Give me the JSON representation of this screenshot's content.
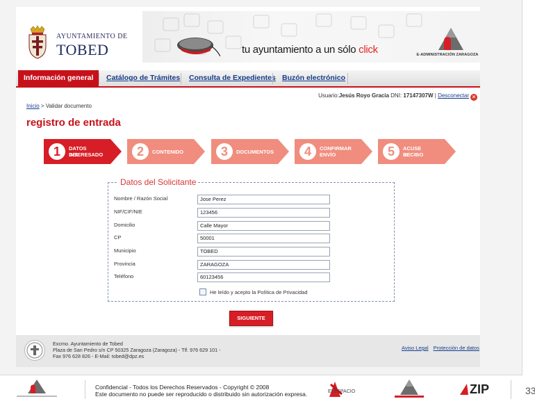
{
  "header": {
    "municipality_prefix": "AYUNTAMIENTO DE",
    "municipality_name": "TOBED",
    "slogan_main": "tu ayuntamiento a un sólo ",
    "slogan_accent": "click",
    "ead_label": "E-ADMINISTRACIÓN ZARAGOZA"
  },
  "nav": {
    "items": [
      {
        "label": "Información general",
        "active": true
      },
      {
        "label": "Catálogo de Trámites",
        "active": false
      },
      {
        "label": "Consulta de Expedientes",
        "active": false
      },
      {
        "label": "Buzón electrónico",
        "active": false
      }
    ]
  },
  "user": {
    "prefix": "Usuario:",
    "name": "Jesús Royo Gracia",
    "dni_label": "DNI:",
    "dni": "17147307W",
    "sep": "|",
    "logout": "Desconectar",
    "logout_icon": "close-icon"
  },
  "breadcrumb": {
    "home": "Inicio",
    "sep": ">",
    "current": "Validar documento"
  },
  "page_title": "registro de entrada",
  "steps": [
    {
      "number": "1",
      "line1": "DATOS DEL",
      "line2": "INTERESADO",
      "active": true
    },
    {
      "number": "2",
      "line1": "CONTENIDO",
      "line2": "",
      "active": false
    },
    {
      "number": "3",
      "line1": "DOCUMENTOS",
      "line2": "",
      "active": false
    },
    {
      "number": "4",
      "line1": "CONFIRMAR",
      "line2": "ENVÍO",
      "active": false
    },
    {
      "number": "5",
      "line1": "ACUSE DE",
      "line2": "RECIBO",
      "active": false
    }
  ],
  "form": {
    "legend": "Datos del Solicitante",
    "fields": [
      {
        "label": "Nombre / Razón Social",
        "value": "Jose Perez"
      },
      {
        "label": "NIF/CIF/NIE",
        "value": "123456"
      },
      {
        "label": "Domicilio",
        "value": "Calle Mayor"
      },
      {
        "label": "CP",
        "value": "50001"
      },
      {
        "label": "Municipio",
        "value": "TOBED"
      },
      {
        "label": "Provincia",
        "value": "ZARAGOZA"
      },
      {
        "label": "Teléfono",
        "value": "60123456"
      }
    ],
    "privacy_label": "He leído y acepto la Política de Privacidad",
    "submit": "SIGUIENTE"
  },
  "footer": {
    "line1": "Excmo. Ayuntamiento de Tobed",
    "line2": "Plaza de San Pedro s/n CP 50325 Zaragoza (Zaragoza) - Tlf. 976 629 101 -",
    "line3": "Fax 976 628 826 - E-Mail: tobed@dpz.es",
    "legal": "Aviso Legal",
    "data_protection": "Protección de datos"
  },
  "slide_footer": {
    "confidential_line1": "Confidencial - Todos los Derechos Reservados - Copyright © 2008",
    "confidential_line2": "Este documento no puede ser reproducido o distribuido sin autorización expresa.",
    "logo_elespacio": "ELESPACIO",
    "logo_zip": "ZIP",
    "page_number": "33"
  },
  "colors": {
    "brand_red": "#c7111a",
    "step_active": "#d71e26",
    "step_inactive": "#f08d7e",
    "link_blue": "#153d8a"
  }
}
